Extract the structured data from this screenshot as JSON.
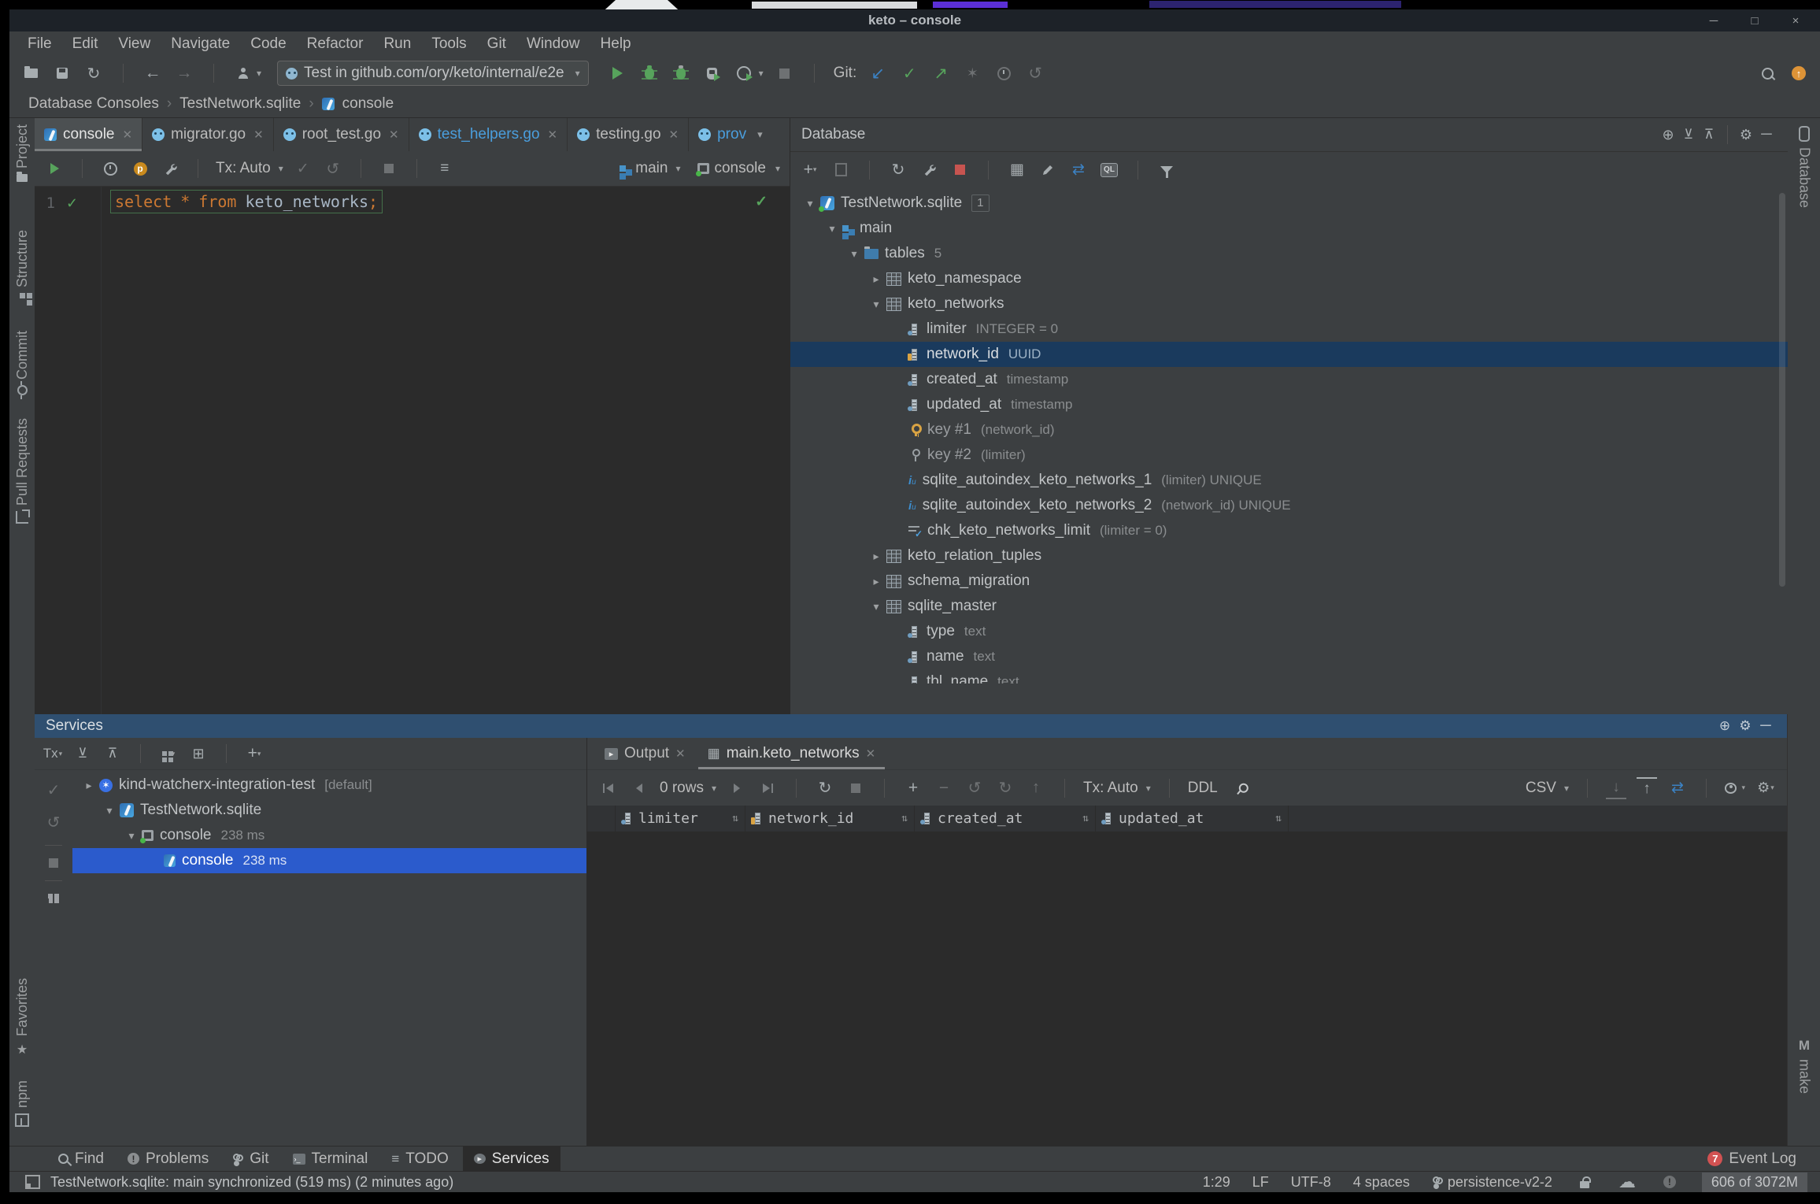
{
  "window": {
    "title": "keto – console"
  },
  "menu": {
    "items": [
      "File",
      "Edit",
      "View",
      "Navigate",
      "Code",
      "Refactor",
      "Run",
      "Tools",
      "Git",
      "Window",
      "Help"
    ]
  },
  "toolbar": {
    "run_config": "Test in github.com/ory/keto/internal/e2e",
    "git_label": "Git:"
  },
  "breadcrumbs": {
    "items": [
      "Database Consoles",
      "TestNetwork.sqlite",
      "console"
    ]
  },
  "editor_tabs": {
    "tabs": [
      {
        "label": "console"
      },
      {
        "label": "migrator.go"
      },
      {
        "label": "root_test.go"
      },
      {
        "label": "test_helpers.go"
      },
      {
        "label": "testing.go"
      },
      {
        "label": "prov"
      }
    ]
  },
  "console_toolbar": {
    "tx": "Tx: Auto",
    "schema": "main",
    "session": "console"
  },
  "editor": {
    "line_number": "1",
    "tokens": {
      "kw_select": "select",
      "op_star": "*",
      "kw_from": "from",
      "ident": "keto_networks",
      "semicolon": ";"
    }
  },
  "database": {
    "title": "Database",
    "stripe_label": "Database",
    "tree": [
      {
        "label": "TestNetwork.sqlite",
        "badge": "1"
      },
      {
        "label": "main"
      },
      {
        "label": "tables",
        "count": "5"
      },
      {
        "label": "keto_namespace"
      },
      {
        "label": "keto_networks"
      },
      {
        "label": "limiter",
        "meta": "INTEGER = 0"
      },
      {
        "label": "network_id",
        "meta": "UUID"
      },
      {
        "label": "created_at",
        "meta": "timestamp"
      },
      {
        "label": "updated_at",
        "meta": "timestamp"
      },
      {
        "label": "key #1",
        "meta": "(network_id)"
      },
      {
        "label": "key #2",
        "meta": "(limiter)"
      },
      {
        "label": "sqlite_autoindex_keto_networks_1",
        "meta": "(limiter) UNIQUE"
      },
      {
        "label": "sqlite_autoindex_keto_networks_2",
        "meta": "(network_id) UNIQUE"
      },
      {
        "label": "chk_keto_networks_limit",
        "meta": "(limiter = 0)"
      },
      {
        "label": "keto_relation_tuples"
      },
      {
        "label": "schema_migration"
      },
      {
        "label": "sqlite_master"
      },
      {
        "label": "type",
        "meta": "text"
      },
      {
        "label": "name",
        "meta": "text"
      },
      {
        "label": "tbl_name",
        "meta": "text"
      }
    ]
  },
  "services": {
    "title": "Services",
    "tx_label": "Tx",
    "tree": [
      {
        "label": "kind-watcherx-integration-test",
        "suffix": "[default]"
      },
      {
        "label": "TestNetwork.sqlite"
      },
      {
        "label": "console",
        "meta": "238 ms"
      },
      {
        "label": "console",
        "meta": "238 ms"
      }
    ],
    "output_tabs": [
      {
        "label": "Output"
      },
      {
        "label": "main.keto_networks"
      }
    ],
    "grid": {
      "rows_label": "0 rows",
      "tx_label": "Tx: Auto",
      "ddl_label": "DDL",
      "csv_label": "CSV",
      "columns": [
        {
          "name": "limiter"
        },
        {
          "name": "network_id"
        },
        {
          "name": "created_at"
        },
        {
          "name": "updated_at"
        }
      ]
    }
  },
  "bottom_bar": {
    "items": [
      "Find",
      "Problems",
      "Git",
      "Terminal",
      "TODO",
      "Services"
    ],
    "event_count": "7",
    "event_log": "Event Log"
  },
  "status_bar": {
    "message": "TestNetwork.sqlite: main synchronized (519 ms) (2 minutes ago)",
    "caret": "1:29",
    "line_sep": "LF",
    "encoding": "UTF-8",
    "indent": "4 spaces",
    "branch": "persistence-v2-2",
    "memory": "606 of 3072M"
  },
  "stripes": {
    "left": [
      "Project",
      "Structure",
      "Commit",
      "Pull Requests"
    ],
    "left_bottom": [
      "Favorites",
      "npm"
    ],
    "right_top": "Database",
    "right_bottom_m": "M",
    "right_bottom": "make"
  }
}
